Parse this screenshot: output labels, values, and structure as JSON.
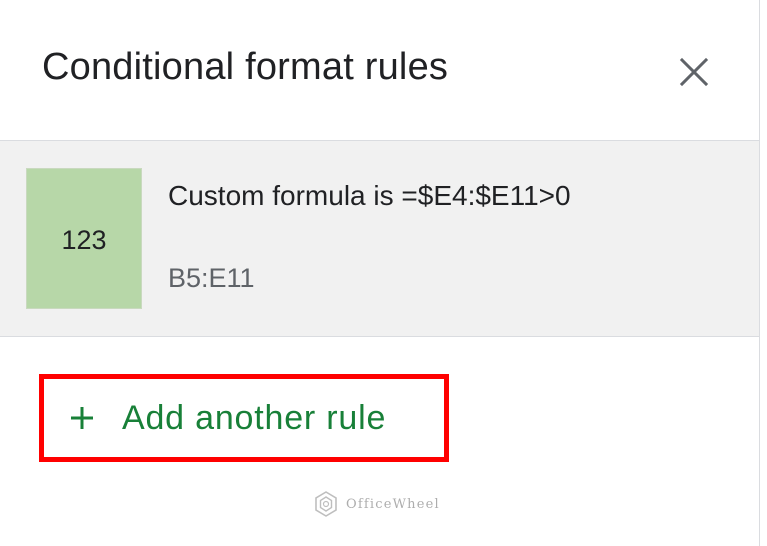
{
  "panel": {
    "title": "Conditional format rules",
    "close_icon": "close-icon"
  },
  "rules": [
    {
      "preview_text": "123",
      "preview_color": "#b7d7a8",
      "condition": "Custom formula is =$E4:$E11>0",
      "range": "B5:E11"
    }
  ],
  "add_rule": {
    "icon": "plus-icon",
    "label": "Add another rule",
    "label_color": "#188038",
    "highlight_color": "#ff0000"
  },
  "watermark": {
    "text": "OfficeWheel",
    "icon": "officewheel-logo-icon"
  }
}
